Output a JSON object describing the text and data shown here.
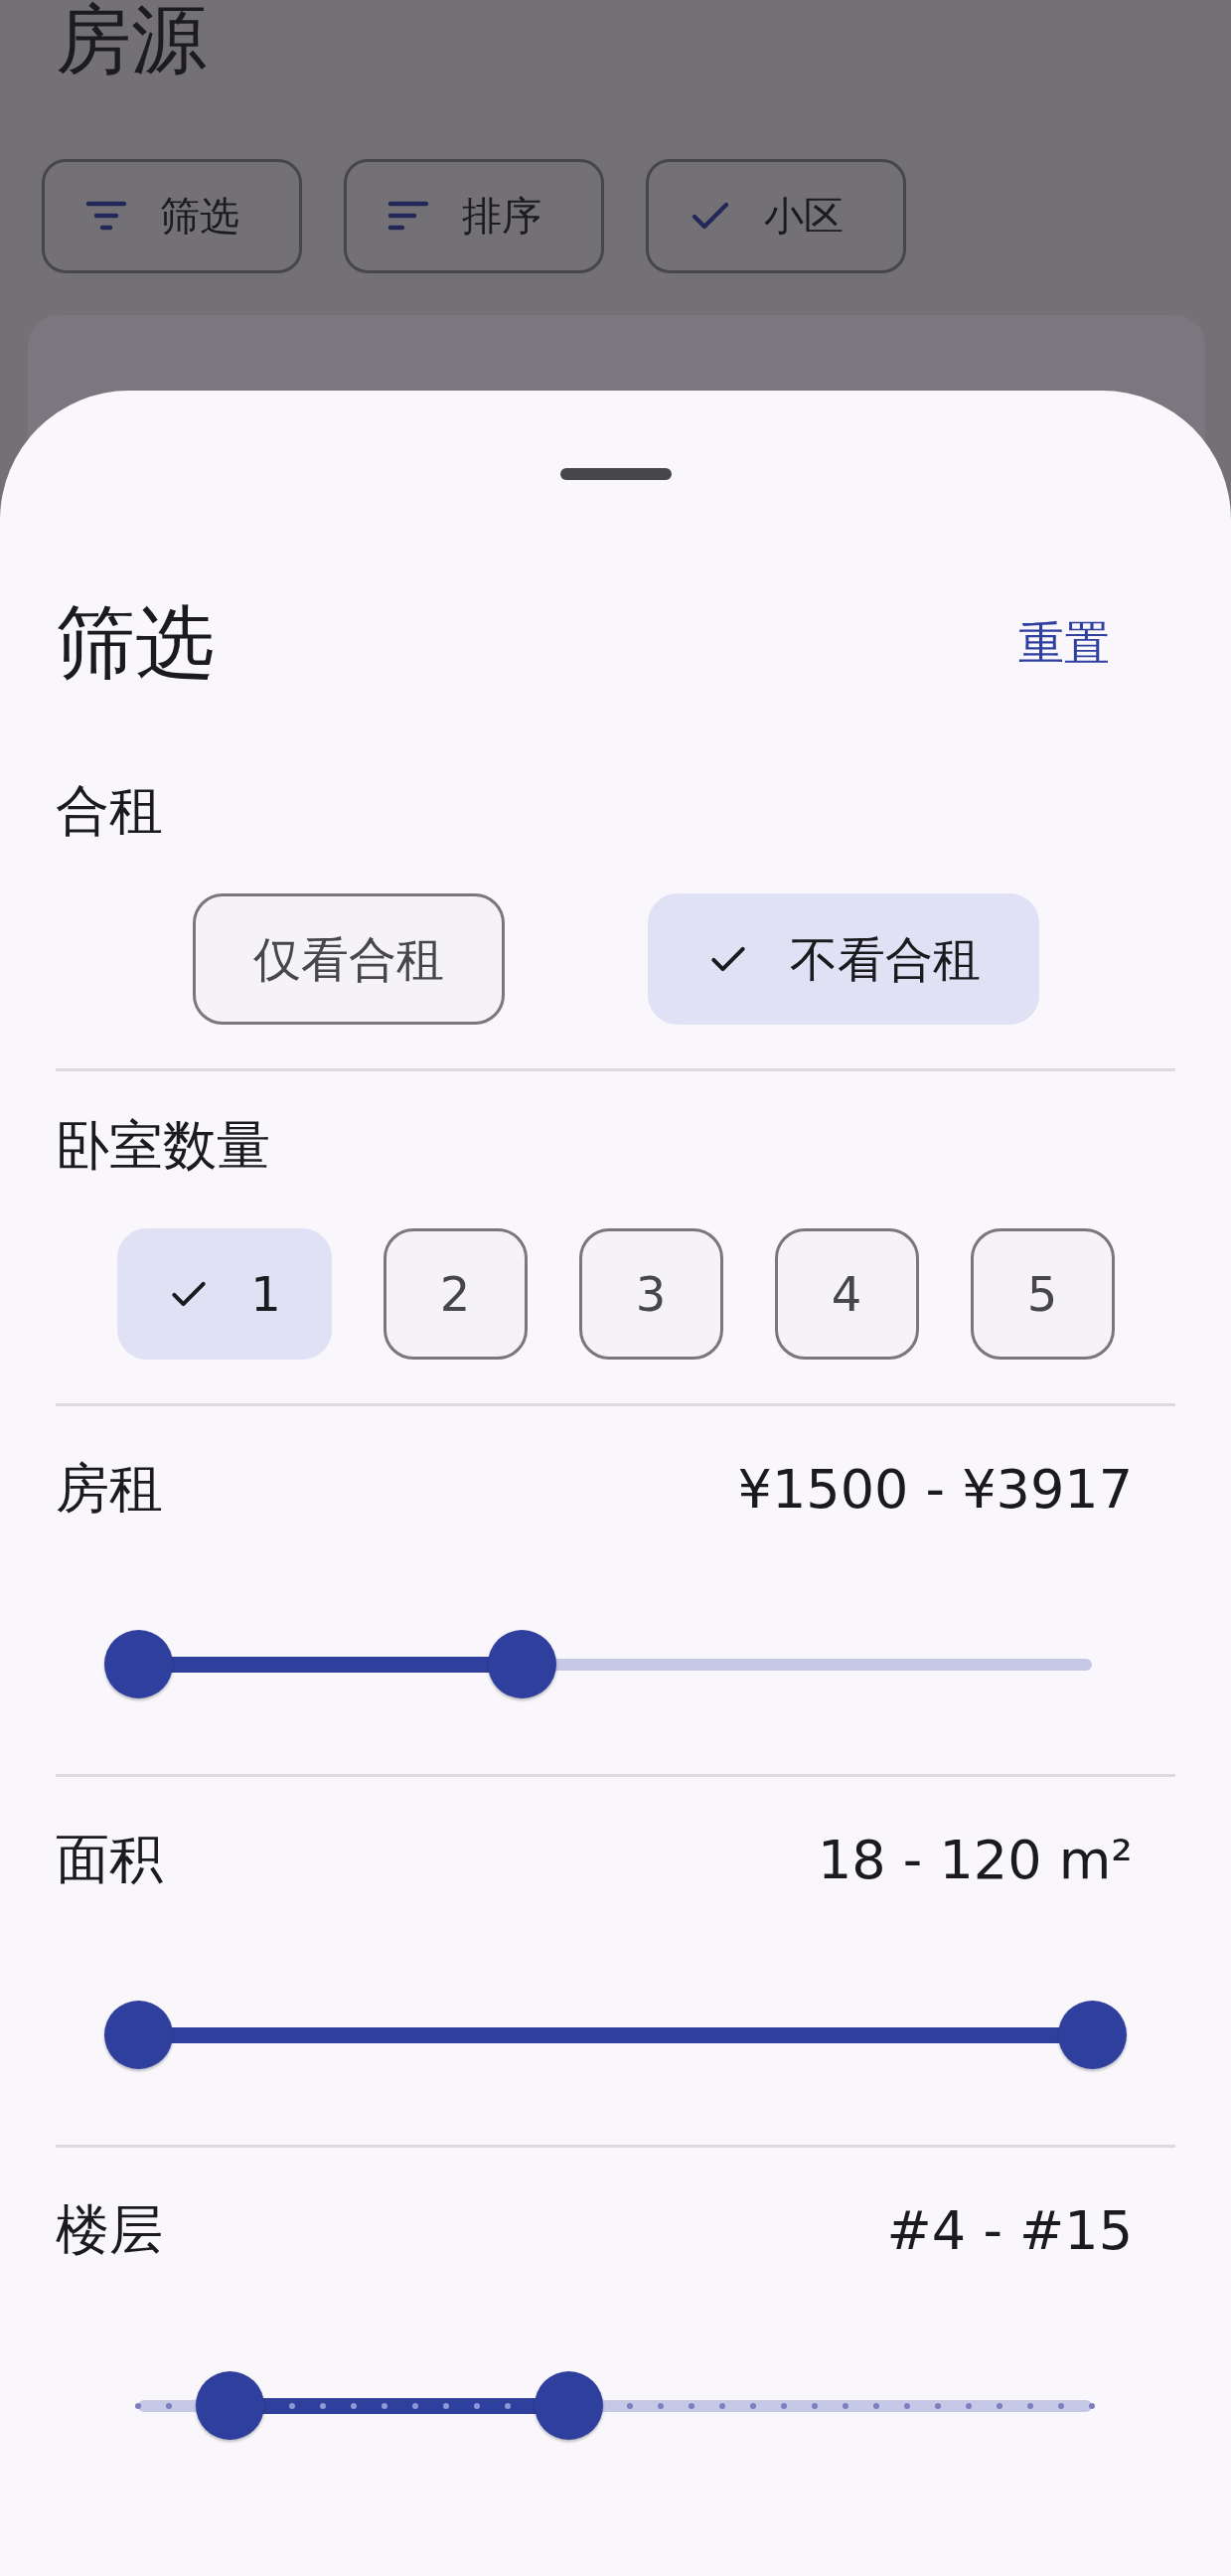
{
  "background": {
    "title": "房源",
    "chips": [
      {
        "label": "筛选"
      },
      {
        "label": "排序"
      },
      {
        "label": "小区"
      }
    ]
  },
  "sheet": {
    "title": "筛选",
    "reset": "重置",
    "sections": [
      {
        "kind": "choice",
        "label": "合租",
        "options": [
          {
            "label": "仅看合租",
            "selected": false
          },
          {
            "label": "不看合租",
            "selected": true
          }
        ]
      },
      {
        "kind": "choice",
        "label": "卧室数量",
        "options": [
          {
            "label": "1",
            "selected": true
          },
          {
            "label": "2",
            "selected": false
          },
          {
            "label": "3",
            "selected": false
          },
          {
            "label": "4",
            "selected": false
          },
          {
            "label": "5",
            "selected": false
          }
        ]
      },
      {
        "kind": "range",
        "label": "房租",
        "reading": "¥1500 - ¥3917",
        "stepped": false,
        "thumbs": [
          {
            "level": 0
          },
          {
            "level": 0.403
          }
        ]
      },
      {
        "kind": "range",
        "label": "面积",
        "reading": "18 - 120 m²",
        "stepped": false,
        "thumbs": [
          {
            "level": 0
          },
          {
            "level": 1
          }
        ]
      },
      {
        "kind": "range",
        "label": "楼层",
        "reading": "#4 - #15",
        "stepped": true,
        "thumbs": [
          {
            "level": 0.0968
          },
          {
            "level": 0.4516
          }
        ]
      }
    ]
  }
}
